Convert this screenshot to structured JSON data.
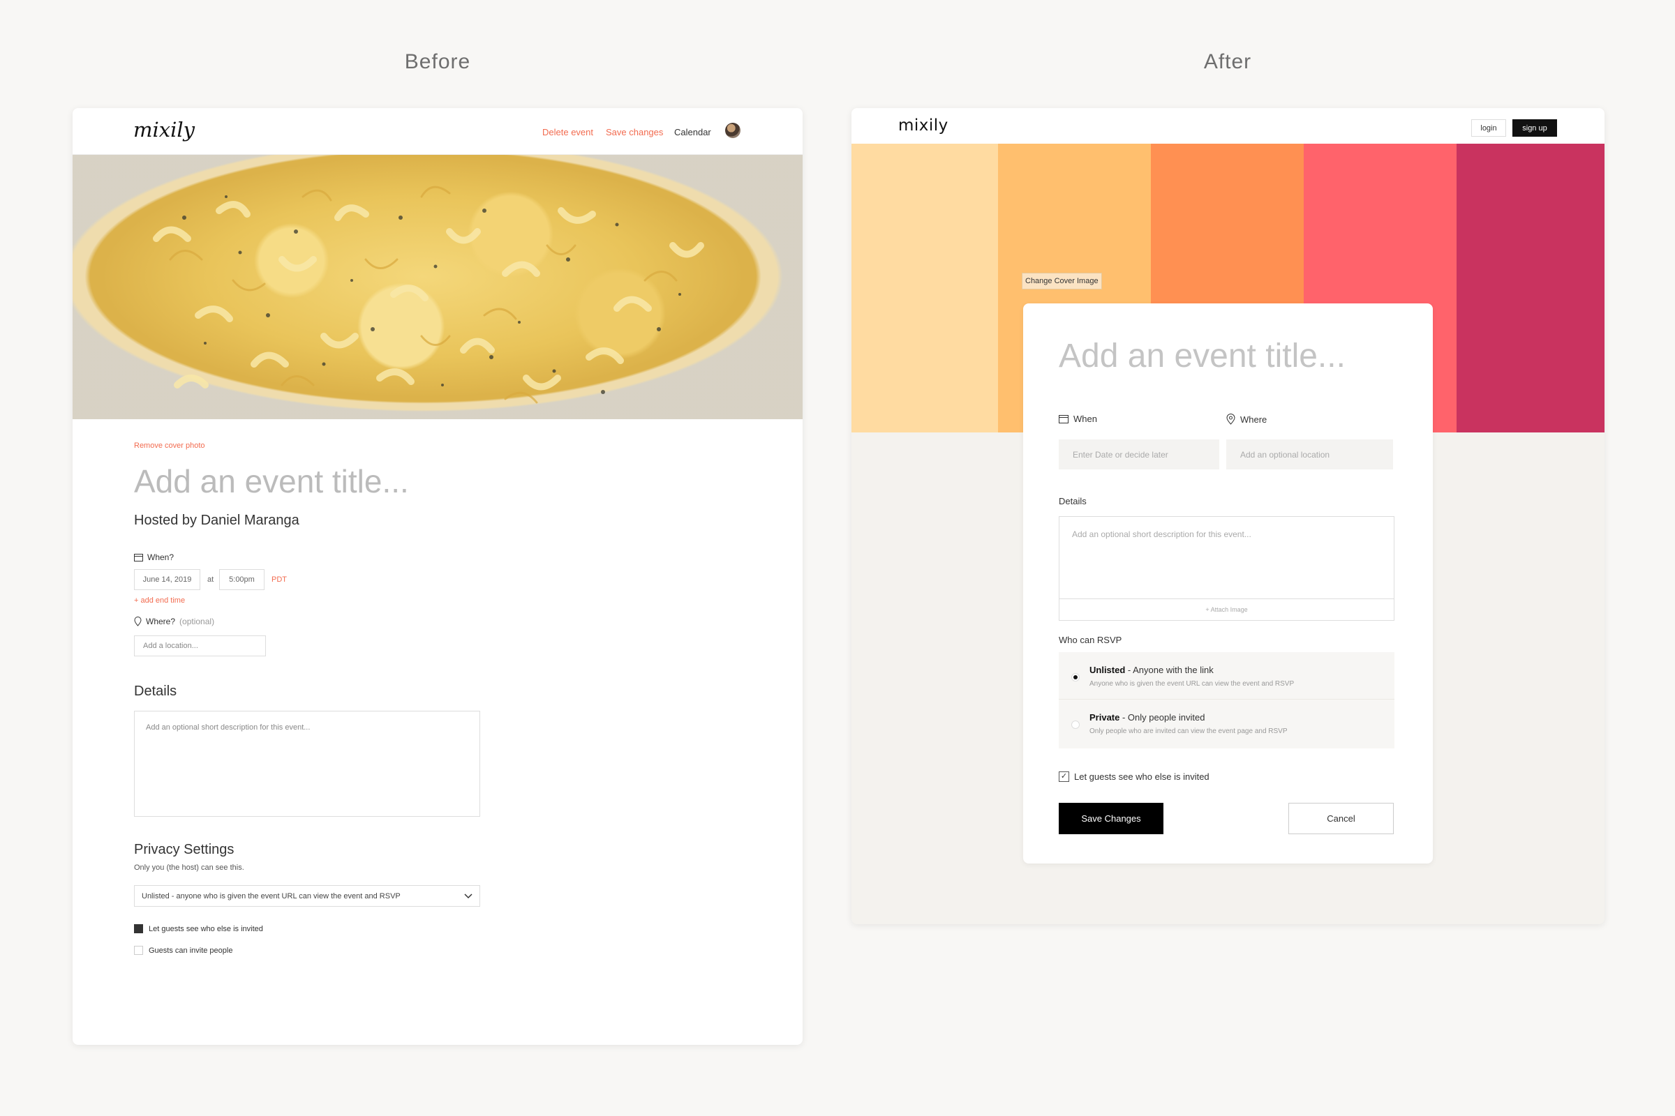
{
  "labels": {
    "before": "Before",
    "after": "After"
  },
  "before": {
    "logo": "mixily",
    "nav": {
      "delete": "Delete event",
      "save": "Save changes",
      "calendar": "Calendar"
    },
    "remove_cover": "Remove cover photo",
    "title_placeholder": "Add an event title...",
    "hosted_by": "Hosted by Daniel Maranga",
    "when_label": "When?",
    "date_value": "June 14, 2019",
    "at": "at",
    "time_value": "5:00pm",
    "timezone": "PDT",
    "add_end_time": "+ add end time",
    "where_label": "Where?",
    "where_optional": "(optional)",
    "location_placeholder": "Add a location...",
    "details_heading": "Details",
    "description_placeholder": "Add an optional short description for this event...",
    "privacy_heading": "Privacy Settings",
    "privacy_sub": "Only you (the host) can see this.",
    "privacy_select": "Unlisted - anyone who is given the event URL can view the event and RSVP",
    "check_guests_see": "Let guests see who else is invited",
    "check_guests_invite": "Guests can invite people",
    "check_guests_see_on": true,
    "check_guests_invite_on": false
  },
  "after": {
    "logo": "mixily",
    "login": "login",
    "signup": "sign up",
    "cover_colors": [
      "#ffdba1",
      "#ffbf6e",
      "#ff9052",
      "#ff636b",
      "#c9335f"
    ],
    "change_cover": "Change Cover Image",
    "title_placeholder": "Add an event title...",
    "when_label": "When",
    "where_label": "Where",
    "date_placeholder": "Enter Date or decide later",
    "location_placeholder": "Add an optional location",
    "details_label": "Details",
    "description_placeholder": "Add an optional short description for this event...",
    "attach_image": "+ Attach Image",
    "rsvp_label": "Who can RSVP",
    "rsvp_options": [
      {
        "title": "Unlisted",
        "title_rest": " - Anyone with the link",
        "subtitle": "Anyone who is given the event URL can view the event and RSVP",
        "selected": true
      },
      {
        "title": "Private",
        "title_rest": " - Only people invited",
        "subtitle": "Only people who are invited can view the event page and RSVP",
        "selected": false
      }
    ],
    "check_guests_see": "Let guests see who else is invited",
    "save": "Save Changes",
    "cancel": "Cancel"
  }
}
